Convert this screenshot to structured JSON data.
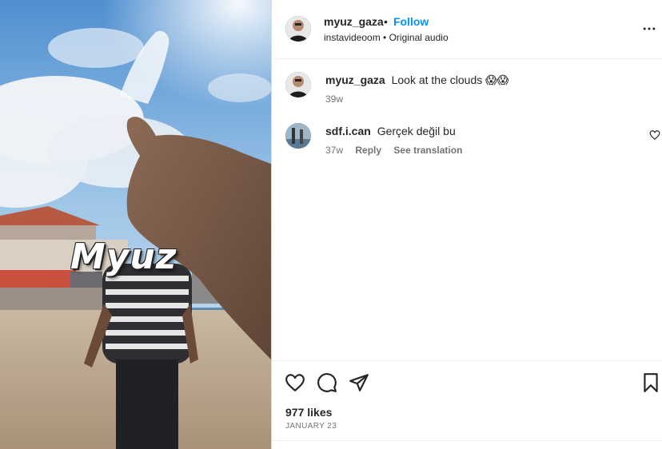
{
  "post": {
    "author": "myuz_gaza",
    "follow_label": "Follow",
    "separator": "•",
    "subtitle": "instavideoom • Original audio",
    "overlay_text": "Myuz"
  },
  "comments": [
    {
      "user": "myuz_gaza",
      "text": "Look at the clouds 😱😱",
      "time": "39w"
    },
    {
      "user": "sdf.i.can",
      "text": "Gerçek değil bu",
      "time": "37w",
      "reply_label": "Reply",
      "translate_label": "See translation"
    }
  ],
  "footer": {
    "likes": "977 likes",
    "date": "JANUARY 23"
  },
  "icons": {
    "like": "heart-icon",
    "comment": "comment-icon",
    "share": "share-icon",
    "save": "bookmark-icon",
    "more": "more-options-icon"
  },
  "colors": {
    "follow": "#0095f6",
    "text": "#262626",
    "muted": "#737373"
  }
}
